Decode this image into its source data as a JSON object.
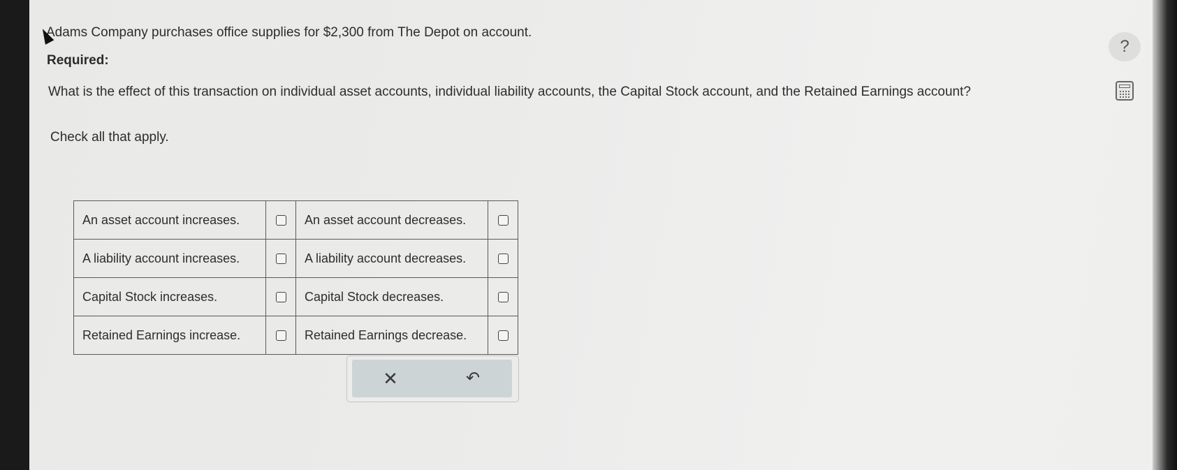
{
  "problem": {
    "intro": "Adams Company purchases office supplies for $2,300 from The Depot on account.",
    "required_label": "Required:",
    "question": "What is the effect of this transaction on individual asset accounts, individual liability accounts, the Capital Stock account, and the Retained Earnings account?",
    "instruction": "Check all that apply."
  },
  "toolbar": {
    "help_label": "?",
    "calculator_icon": "calculator-icon"
  },
  "options": [
    {
      "left": "An asset account increases.",
      "left_checked": false,
      "right": "An asset account decreases.",
      "right_checked": false
    },
    {
      "left": "A liability account increases.",
      "left_checked": false,
      "right": "A liability account decreases.",
      "right_checked": false
    },
    {
      "left": "Capital Stock increases.",
      "left_checked": false,
      "right": "Capital Stock decreases.",
      "right_checked": false
    },
    {
      "left": "Retained Earnings increase.",
      "left_checked": false,
      "right": "Retained Earnings decrease.",
      "right_checked": false
    }
  ],
  "actions": {
    "clear_label": "✕",
    "undo_label": "↶"
  }
}
